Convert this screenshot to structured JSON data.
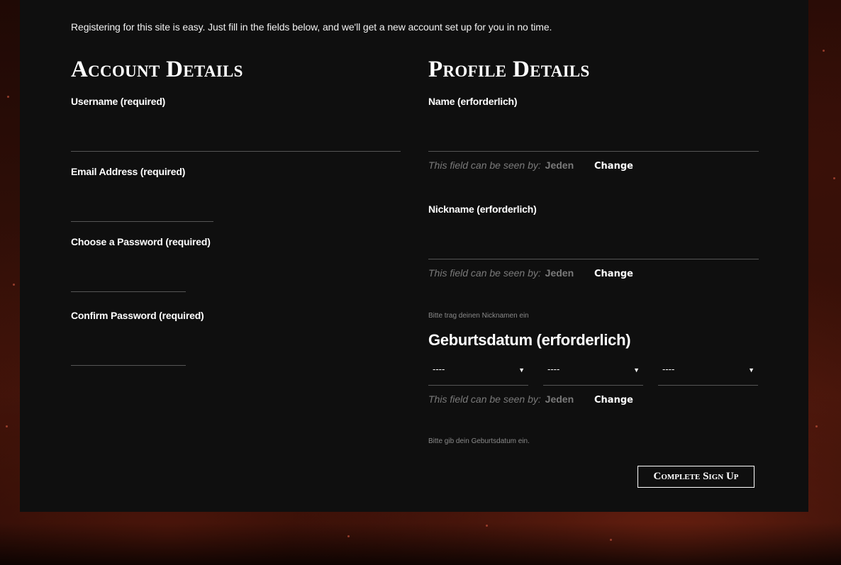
{
  "intro": "Registering for this site is easy. Just fill in the fields below, and we'll get a new account set up for you in no time.",
  "account": {
    "heading": "Account Details",
    "username_label": "Username (required)",
    "email_label": "Email Address (required)",
    "password_label": "Choose a Password (required)",
    "confirm_label": "Confirm Password (required)"
  },
  "profile": {
    "heading": "Profile Details",
    "name_label": "Name (erforderlich)",
    "nickname_label": "Nickname (erforderlich)",
    "nickname_hint": "Bitte trag deinen Nicknamen ein",
    "birthday_label": "Geburtsdatum (erforderlich)",
    "birthday_hint": "Bitte gib dein Geburtsdatum ein.",
    "visibility_text": "This field can be seen by:",
    "visibility_value": "Jeden",
    "change_label": "Change",
    "day_value": "----",
    "month_value": "----",
    "year_value": "----"
  },
  "submit_label": "Complete Sign Up"
}
